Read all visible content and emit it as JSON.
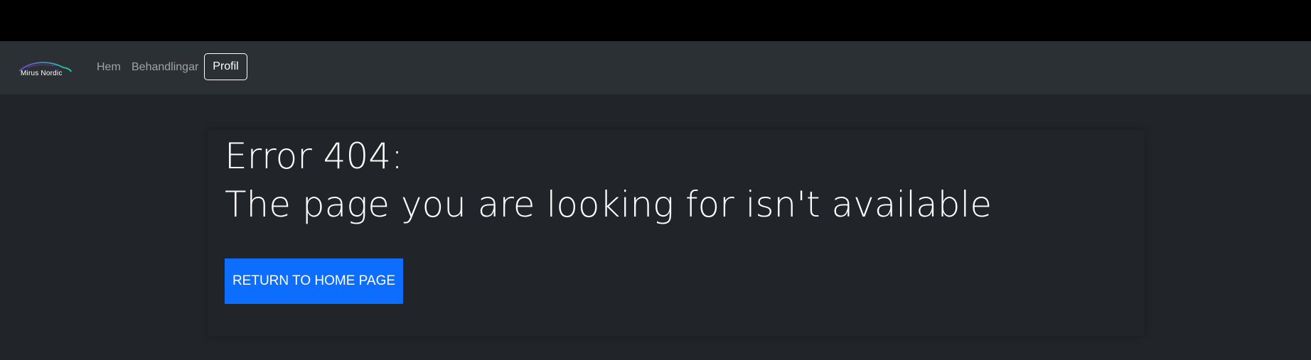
{
  "brand": {
    "name": "Mirus Nordic",
    "logo_icon": "car-silhouette-icon",
    "colors": [
      "#6f42c1",
      "#20c997"
    ]
  },
  "nav": {
    "items": [
      {
        "label": "Hem"
      },
      {
        "label": "Behandlingar"
      },
      {
        "label": "Profil",
        "active": true
      }
    ]
  },
  "main": {
    "error_heading": "Error 404:",
    "error_message": "The page you are looking for isn't available",
    "return_button": "RETURN TO HOME PAGE"
  },
  "colors": {
    "background": "#212529",
    "navbar": "#2b3035",
    "topbar": "#000000",
    "accent": "#0d6efd"
  }
}
